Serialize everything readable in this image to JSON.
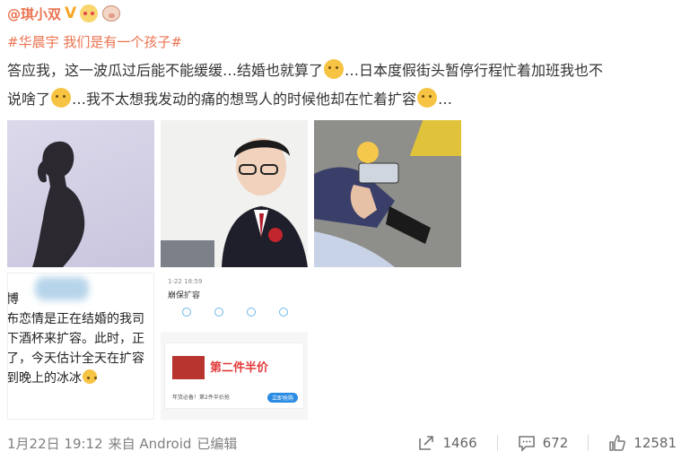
{
  "post": {
    "username": "@琪小双",
    "topic": "#华晨宇 我们是有一个孩子#",
    "text_line1_part1": "答应我，这一波瓜过后能不能缓缓…结婚也就算了",
    "text_line1_part2": "…日本度假街头暂停行程忙着加班我也不",
    "text_line2_part1": "说啥了",
    "text_line2_part2": "…我不太想我发动的痛的想骂人的时候他却在忙着扩容",
    "text_line2_part3": "…",
    "screenshot_text": {
      "line1": "博",
      "line2": "布恋情是正在结婚的我司",
      "line3": "下酒杯来扩容。此时，正",
      "line4": "了，今天估计全天在扩容",
      "line5": "到晚上的冰冰"
    },
    "mini_card": {
      "line_a": "1-22 18:59",
      "line_b": "崩保扩容",
      "ad_title": "第二件半价",
      "ad_caption": "年货必备！第2件半价抢",
      "ad_button": "立即抢购"
    }
  },
  "footer": {
    "date": "1月22日 19:12",
    "source": "来自 Android",
    "edited": "已编辑",
    "reposts": "1466",
    "comments": "672",
    "likes": "12581"
  },
  "colors": {
    "accent": "#eb7350",
    "text": "#333333",
    "meta": "#808080"
  },
  "icons": [
    "verified-v-icon",
    "heart-eyes-emoji-icon",
    "pig-emoji-icon",
    "doge-emoji-icon",
    "repost-icon",
    "comment-icon",
    "like-icon"
  ]
}
